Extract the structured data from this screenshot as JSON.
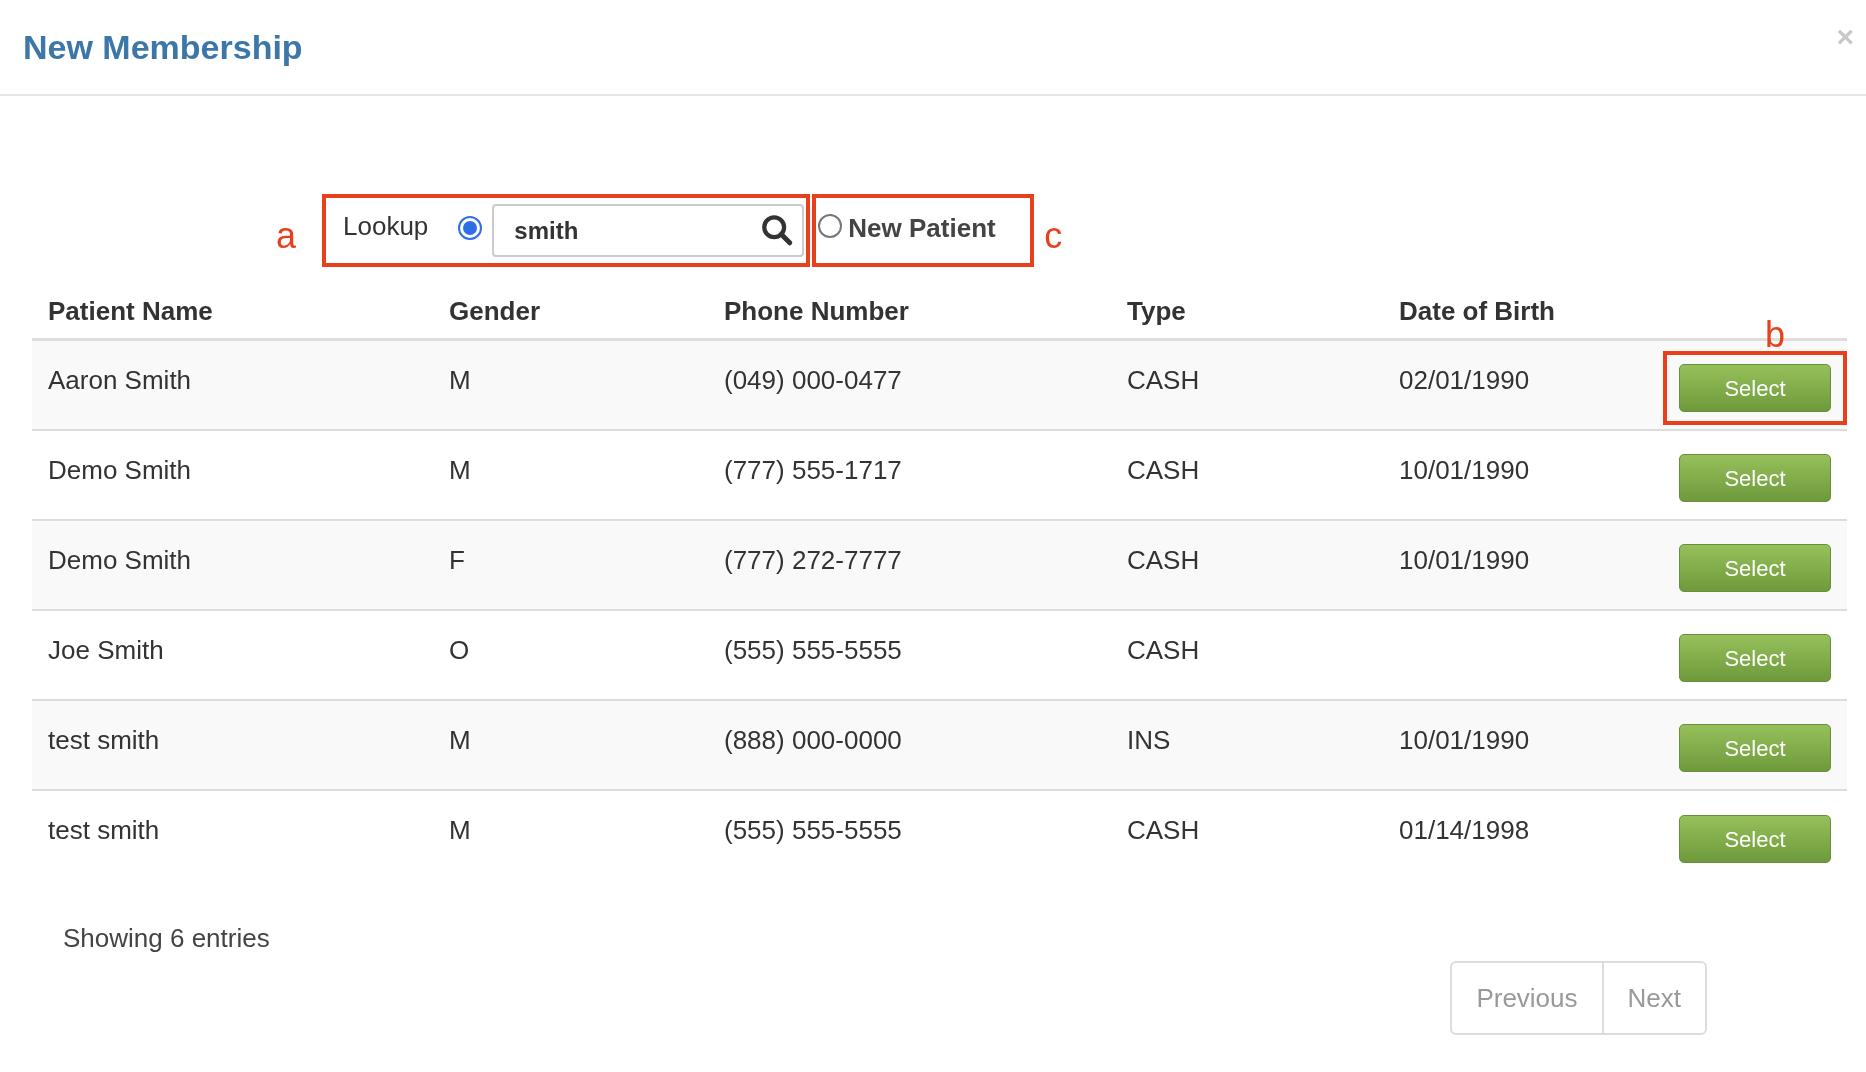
{
  "dialog": {
    "title": "New Membership",
    "close": "×"
  },
  "search": {
    "options": [
      {
        "label": "Lookup",
        "selected": true,
        "annotation": "a"
      },
      {
        "label": "New Patient",
        "selected": false,
        "annotation": "c"
      }
    ],
    "value": "smith"
  },
  "table": {
    "columns": [
      "Patient Name",
      "Gender",
      "Phone Number",
      "Type",
      "Date of Birth"
    ],
    "rows": [
      {
        "cells": [
          "Aaron Smith",
          "M",
          "(049) 000-0477",
          "CASH",
          "02/01/1990"
        ],
        "action": "Select",
        "annotation": "b"
      },
      {
        "cells": [
          "Demo Smith",
          "M",
          "(777) 555-1717",
          "CASH",
          "10/01/1990"
        ],
        "action": "Select"
      },
      {
        "cells": [
          "Demo Smith",
          "F",
          "(777) 272-7777",
          "CASH",
          "10/01/1990"
        ],
        "action": "Select"
      },
      {
        "cells": [
          "Joe Smith",
          "O",
          "(555) 555-5555",
          "CASH",
          ""
        ],
        "action": "Select"
      },
      {
        "cells": [
          "test smith",
          "M",
          "(888) 000-0000",
          "INS",
          "10/01/1990"
        ],
        "action": "Select"
      },
      {
        "cells": [
          "test smith",
          "M",
          "(555) 555-5555",
          "CASH",
          "01/14/1998"
        ],
        "action": "Select"
      }
    ]
  },
  "footer": {
    "info": "Showing 6 entries",
    "pagination": [
      {
        "label": "Previous",
        "disabled": true
      },
      {
        "label": "Next",
        "disabled": true
      }
    ]
  }
}
